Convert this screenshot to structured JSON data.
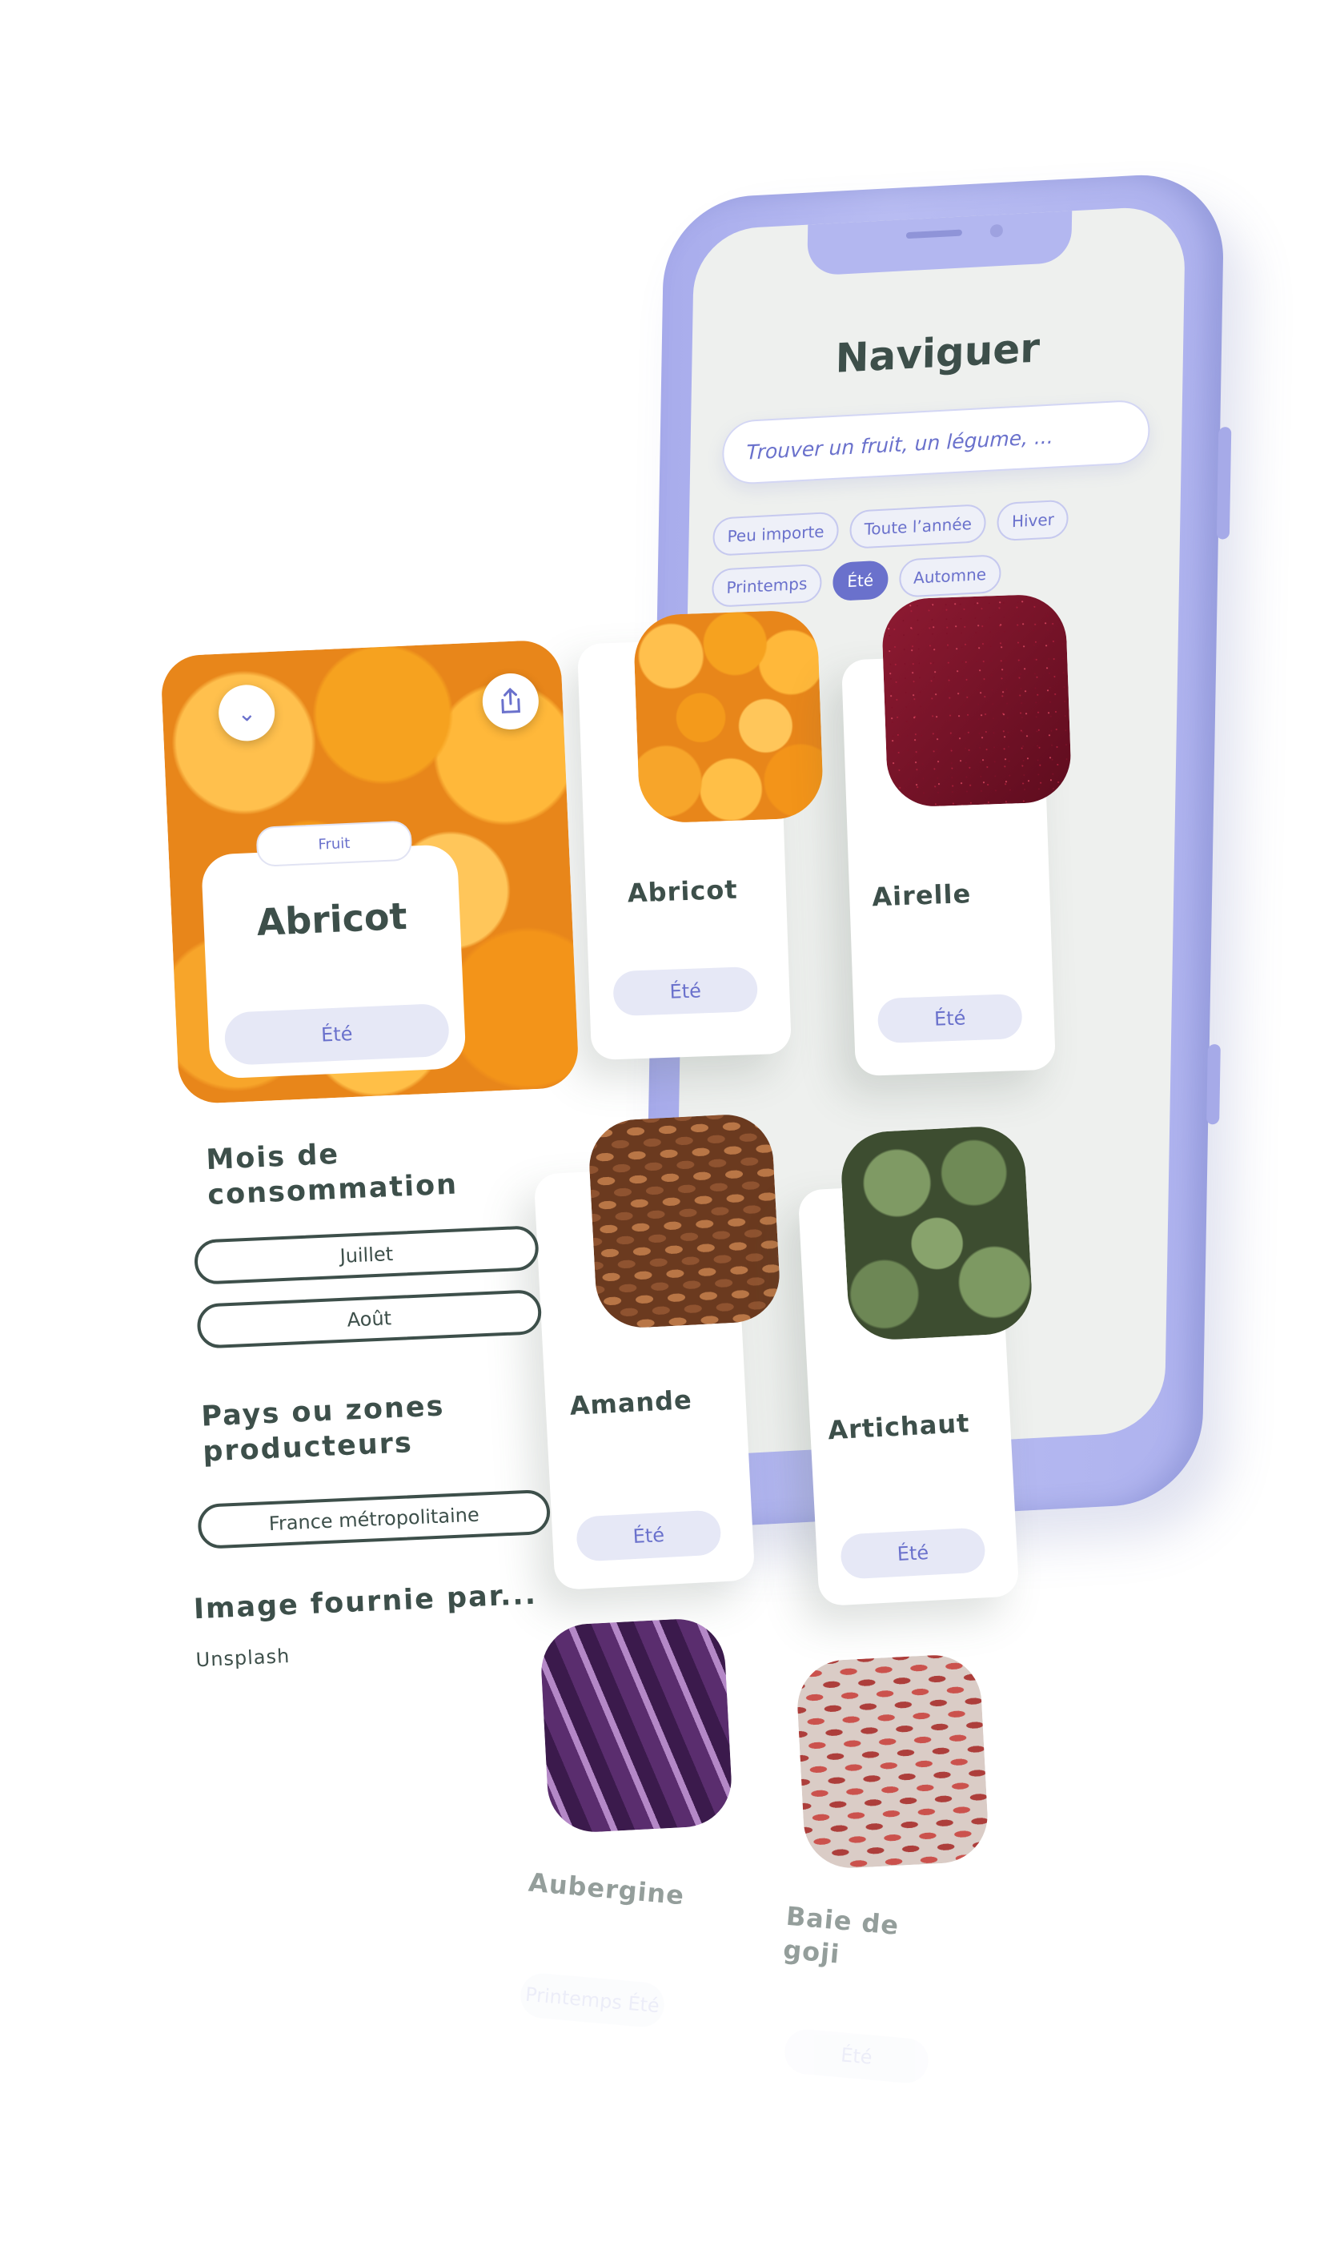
{
  "browse_screen": {
    "title": "Naviguer",
    "search_placeholder": "Trouver un fruit, un légume, ...",
    "season_filters": [
      "Peu importe",
      "Toute l’année",
      "Hiver",
      "Printemps",
      "Été",
      "Automne"
    ],
    "active_filter": "Été"
  },
  "products": [
    {
      "name": "Abricot",
      "season": "Été",
      "image": "apricot-photo"
    },
    {
      "name": "Airelle",
      "season": "Été",
      "image": "cranberry-photo"
    },
    {
      "name": "Amande",
      "season": "Été",
      "image": "almond-photo"
    },
    {
      "name": "Artichaut",
      "season": "Été",
      "image": "artichoke-photo"
    },
    {
      "name": "Aubergine",
      "season": "Printemps Été",
      "image": "eggplant-photo"
    },
    {
      "name": "Baie de goji",
      "season": "Été",
      "image": "goji-photo"
    }
  ],
  "detail": {
    "category": "Fruit",
    "name": "Abricot",
    "season": "Été",
    "months_heading": "Mois de consommation",
    "months": [
      "Juillet",
      "Août"
    ],
    "producers_heading": "Pays ou zones producteurs",
    "producers": [
      "France métropolitaine"
    ],
    "credit_heading": "Image fournie par...",
    "credit_value": "Unsplash"
  },
  "colors": {
    "accent": "#6a71cc",
    "phone_frame": "#aeb2ee",
    "text_dark": "#3d4f4a",
    "chip_bg": "#e6e8f6"
  }
}
